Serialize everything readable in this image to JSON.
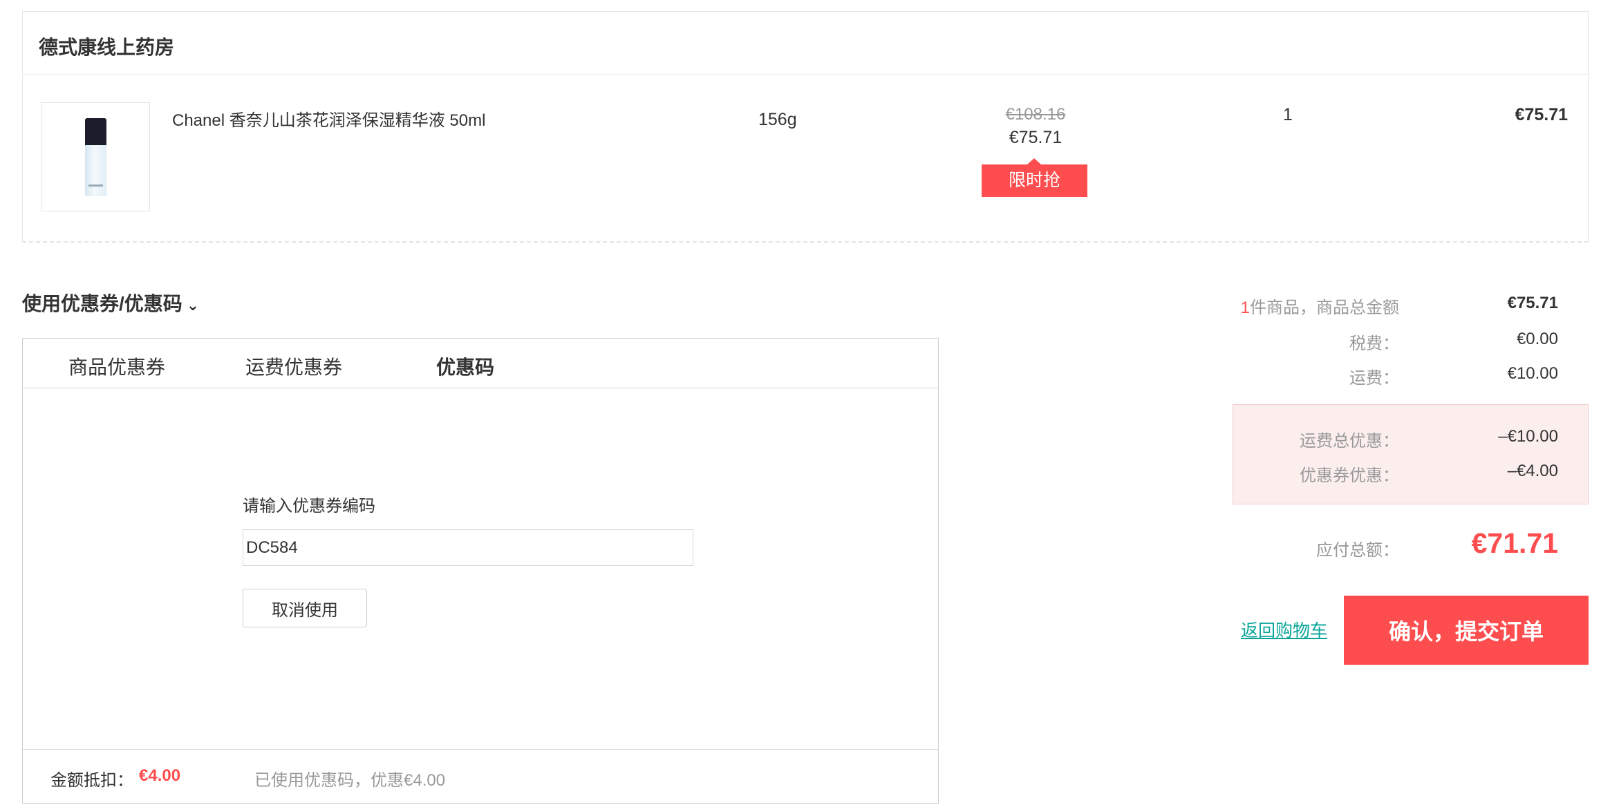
{
  "store": {
    "name": "德式康线上药房"
  },
  "product": {
    "image_icon": "product-bottle-image",
    "name": "Chanel 香奈儿山茶花润泽保湿精华液 50ml",
    "weight": "156g",
    "original_price": "€108.16",
    "price": "€75.71",
    "badge": "限时抢",
    "quantity": "1",
    "subtotal": "€75.71"
  },
  "coupon": {
    "title": "使用优惠券/优惠码",
    "toggle_icon": "chevron-down-icon",
    "tabs": [
      {
        "label": "商品优惠券",
        "active": false
      },
      {
        "label": "运费优惠券",
        "active": false
      },
      {
        "label": "优惠码",
        "active": true
      }
    ],
    "code_label": "请输入优惠券编码",
    "code_value": "DC584",
    "cancel_label": "取消使用",
    "deduct_label": "金额抵扣：",
    "deduct_value": "€4.00",
    "used_note": "已使用优惠码，优惠€4.00"
  },
  "summary": {
    "item_count": "1",
    "items_label": "件商品，商品总金额",
    "items_total": "€75.71",
    "tax_label": "税费：",
    "tax_value": "€0.00",
    "shipping_label": "运费：",
    "shipping_value": "€10.00",
    "shipping_discount_label": "运费总优惠：",
    "shipping_discount_value": "–€10.00",
    "coupon_discount_label": "优惠券优惠：",
    "coupon_discount_value": "–€4.00",
    "payable_label": "应付总额：",
    "payable_value": "€71.71",
    "back_link": "返回购物车",
    "submit_label": "确认，提交订单"
  },
  "colors": {
    "accent": "#fe4d4f",
    "link": "#0aa59a",
    "discount_bg": "#fdeeee"
  }
}
